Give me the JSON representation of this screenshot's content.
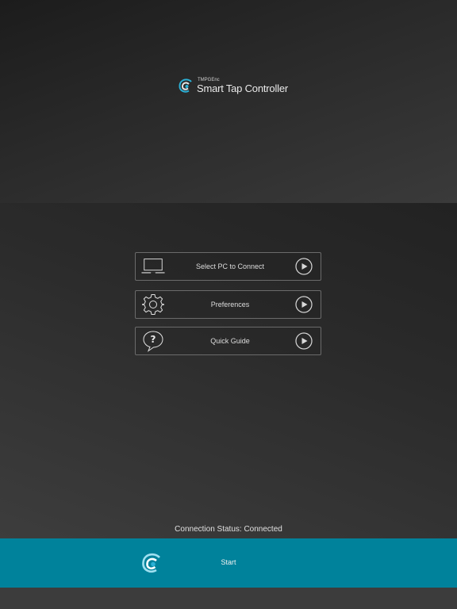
{
  "header": {
    "brand_small": "TMPGEnc",
    "app_name": "Smart Tap Controller",
    "logo_icon": "wave-logo-icon"
  },
  "menu": [
    {
      "label": "Select PC to Connect",
      "icon": "laptop-icon"
    },
    {
      "label": "Preferences",
      "icon": "gear-icon"
    },
    {
      "label": "Quick Guide",
      "icon": "help-bubble-icon"
    }
  ],
  "status": {
    "text": "Connection Status: Connected"
  },
  "start": {
    "label": "Start",
    "icon": "wave-logo-icon"
  },
  "colors": {
    "accent": "#00829b",
    "background": "#262626",
    "border": "#6b6b6b"
  }
}
